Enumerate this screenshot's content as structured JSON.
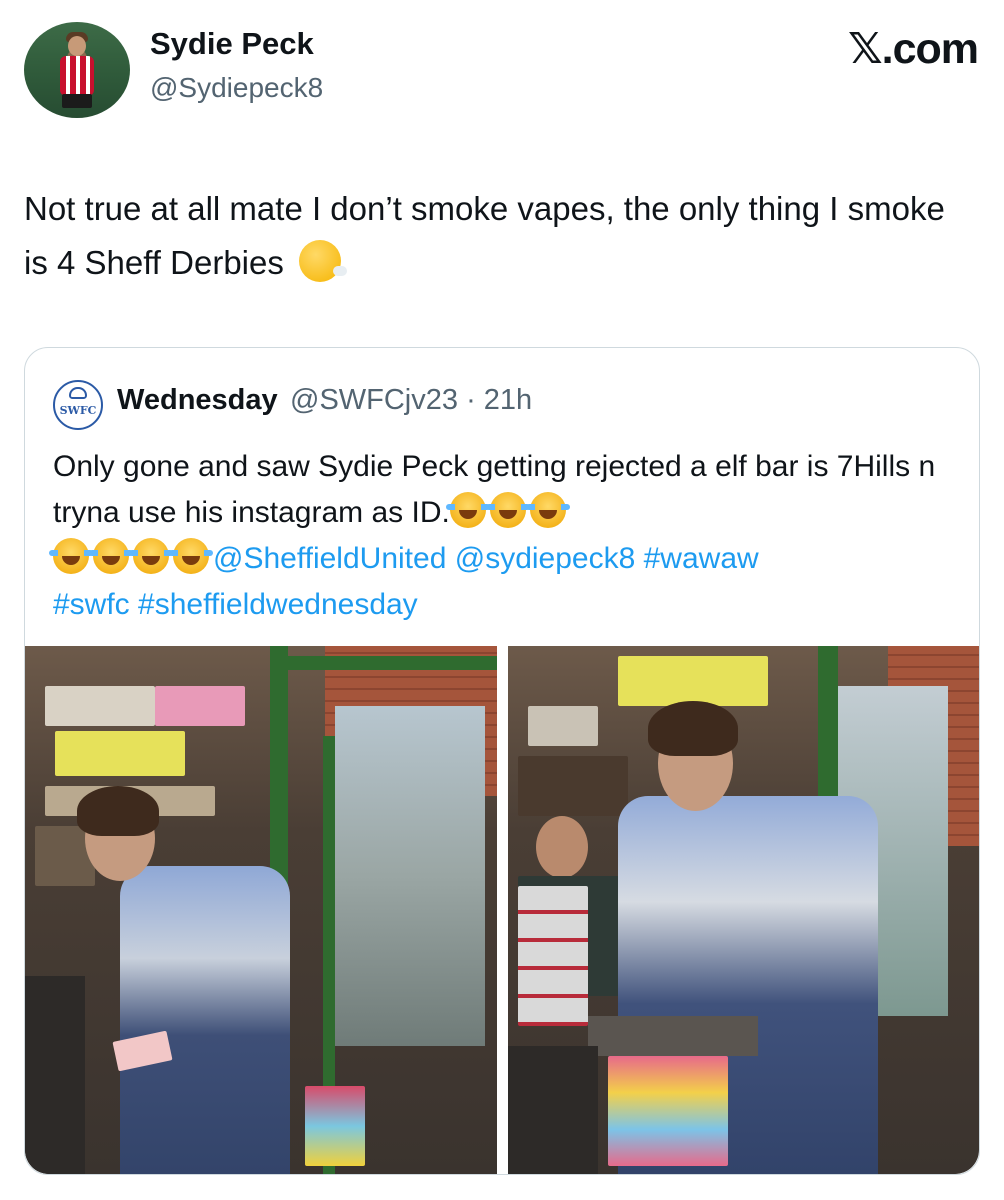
{
  "author": {
    "name": "Sydie Peck",
    "handle": "@Sydiepeck8"
  },
  "brand": "𝕏.com",
  "tweet": {
    "text": "Not true at all mate I don’t smoke vapes, the only thing I smoke is 4 Sheff Derbies"
  },
  "quoted": {
    "avatar_text": "SWFC",
    "name": "Wednesday",
    "meta": "@SWFCjv23 · 21h",
    "text_main": "Only gone and saw Sydie Peck getting rejected a elf bar is 7Hills n tryna use his instagram as ID.",
    "mention1": "@SheffieldUnited",
    "mention2": "@sydiepeck8",
    "hashtag1": "#wawaw",
    "hashtag2": "#swfc",
    "hashtag3": "#sheffieldwednesday"
  },
  "icons": {
    "emoji_tweet": "face-exhaling-emoji",
    "emoji_quote": "tears-of-joy-emoji"
  },
  "colors": {
    "link": "#1d9bf0",
    "secondary_text": "#536471",
    "border": "#cfd9de"
  }
}
